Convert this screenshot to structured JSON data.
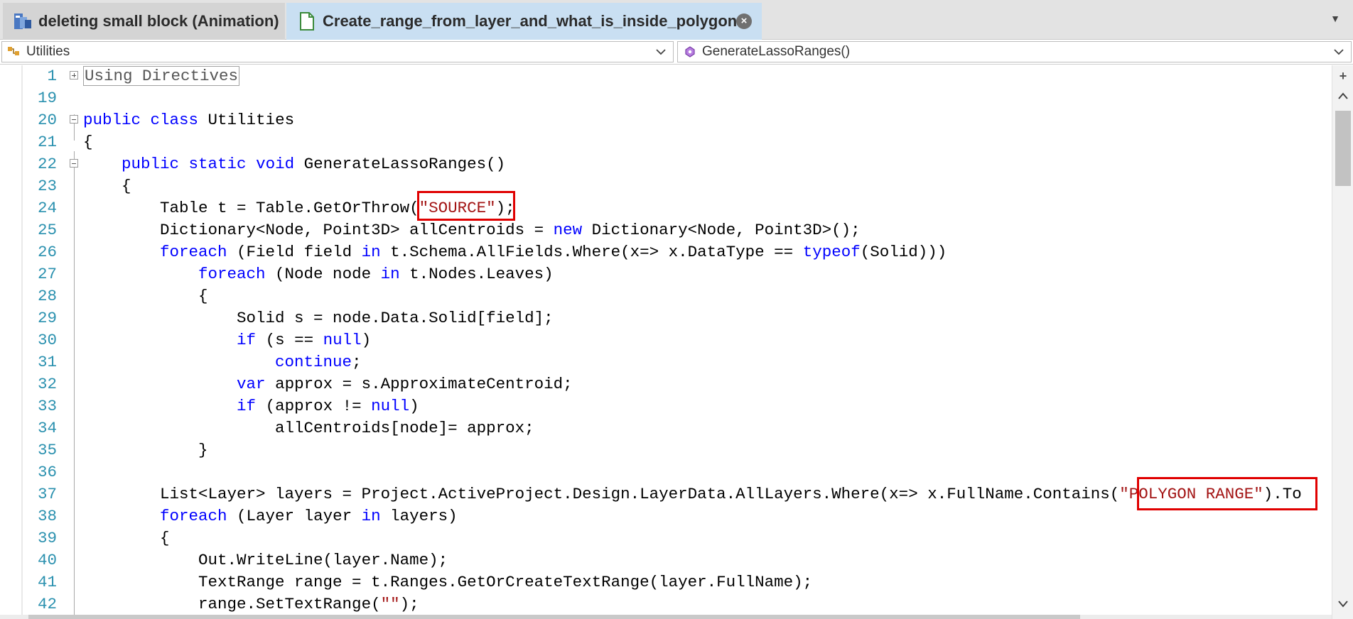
{
  "tabs": [
    {
      "label": "deleting small block (Animation)",
      "icon": "animation-project-icon",
      "active": false
    },
    {
      "label": "Create_range_from_layer_and_what_is_inside_polygon",
      "icon": "document-icon",
      "active": true
    }
  ],
  "navigation": {
    "type_dropdown": {
      "value": "Utilities",
      "icon": "class-icon"
    },
    "member_dropdown": {
      "value": "GenerateLassoRanges()",
      "icon": "method-icon"
    }
  },
  "editor": {
    "lines": [
      {
        "num": "1",
        "fold": "plus",
        "tokens": [
          {
            "t": "Using Directives",
            "c": "collapsed"
          }
        ]
      },
      {
        "num": "19",
        "fold": "",
        "tokens": []
      },
      {
        "num": "20",
        "fold": "minus",
        "tokens": [
          {
            "t": "public",
            "c": "kw"
          },
          {
            "t": " "
          },
          {
            "t": "class",
            "c": "kw"
          },
          {
            "t": " Utilities"
          }
        ]
      },
      {
        "num": "21",
        "fold": "",
        "tokens": [
          {
            "t": "{"
          }
        ]
      },
      {
        "num": "22",
        "fold": "minus",
        "tokens": [
          {
            "t": "    "
          },
          {
            "t": "public",
            "c": "kw"
          },
          {
            "t": " "
          },
          {
            "t": "static",
            "c": "kw"
          },
          {
            "t": " "
          },
          {
            "t": "void",
            "c": "kw"
          },
          {
            "t": " GenerateLassoRanges()"
          }
        ]
      },
      {
        "num": "23",
        "fold": "",
        "tokens": [
          {
            "t": "    {"
          }
        ]
      },
      {
        "num": "24",
        "fold": "",
        "tokens": [
          {
            "t": "        Table t = Table.GetOrThrow("
          },
          {
            "t": "\"SOURCE\"",
            "c": "str"
          },
          {
            "t": ");"
          }
        ]
      },
      {
        "num": "25",
        "fold": "",
        "tokens": [
          {
            "t": "        Dictionary<Node, Point3D> allCentroids = "
          },
          {
            "t": "new",
            "c": "kw"
          },
          {
            "t": " Dictionary<Node, Point3D>();"
          }
        ]
      },
      {
        "num": "26",
        "fold": "",
        "tokens": [
          {
            "t": "        "
          },
          {
            "t": "foreach",
            "c": "kw"
          },
          {
            "t": " (Field field "
          },
          {
            "t": "in",
            "c": "kw"
          },
          {
            "t": " t.Schema.AllFields.Where(x=> x.DataType == "
          },
          {
            "t": "typeof",
            "c": "kw"
          },
          {
            "t": "(Solid)))"
          }
        ]
      },
      {
        "num": "27",
        "fold": "",
        "tokens": [
          {
            "t": "            "
          },
          {
            "t": "foreach",
            "c": "kw"
          },
          {
            "t": " (Node node "
          },
          {
            "t": "in",
            "c": "kw"
          },
          {
            "t": " t.Nodes.Leaves)"
          }
        ]
      },
      {
        "num": "28",
        "fold": "",
        "tokens": [
          {
            "t": "            {"
          }
        ]
      },
      {
        "num": "29",
        "fold": "",
        "tokens": [
          {
            "t": "                Solid s = node.Data.Solid[field];"
          }
        ]
      },
      {
        "num": "30",
        "fold": "",
        "tokens": [
          {
            "t": "                "
          },
          {
            "t": "if",
            "c": "kw"
          },
          {
            "t": " (s == "
          },
          {
            "t": "null",
            "c": "kw"
          },
          {
            "t": ")"
          }
        ]
      },
      {
        "num": "31",
        "fold": "",
        "tokens": [
          {
            "t": "                    "
          },
          {
            "t": "continue",
            "c": "kw"
          },
          {
            "t": ";"
          }
        ]
      },
      {
        "num": "32",
        "fold": "",
        "tokens": [
          {
            "t": "                "
          },
          {
            "t": "var",
            "c": "kw"
          },
          {
            "t": " approx = s.ApproximateCentroid;"
          }
        ]
      },
      {
        "num": "33",
        "fold": "",
        "tokens": [
          {
            "t": "                "
          },
          {
            "t": "if",
            "c": "kw"
          },
          {
            "t": " (approx != "
          },
          {
            "t": "null",
            "c": "kw"
          },
          {
            "t": ")"
          }
        ]
      },
      {
        "num": "34",
        "fold": "",
        "tokens": [
          {
            "t": "                    allCentroids[node]= approx;"
          }
        ]
      },
      {
        "num": "35",
        "fold": "",
        "tokens": [
          {
            "t": "            }"
          }
        ]
      },
      {
        "num": "36",
        "fold": "",
        "tokens": []
      },
      {
        "num": "37",
        "fold": "",
        "tokens": [
          {
            "t": "        List<Layer> layers = Project.ActiveProject.Design.LayerData.AllLayers.Where(x=> x.FullName.Contains("
          },
          {
            "t": "\"POLYGON RANGE\"",
            "c": "str"
          },
          {
            "t": ").To"
          }
        ]
      },
      {
        "num": "38",
        "fold": "",
        "tokens": [
          {
            "t": "        "
          },
          {
            "t": "foreach",
            "c": "kw"
          },
          {
            "t": " (Layer layer "
          },
          {
            "t": "in",
            "c": "kw"
          },
          {
            "t": " layers)"
          }
        ]
      },
      {
        "num": "39",
        "fold": "",
        "tokens": [
          {
            "t": "        {"
          }
        ]
      },
      {
        "num": "40",
        "fold": "",
        "tokens": [
          {
            "t": "            Out.WriteLine(layer.Name);"
          }
        ]
      },
      {
        "num": "41",
        "fold": "",
        "tokens": [
          {
            "t": "            TextRange range = t.Ranges.GetOrCreateTextRange(layer.FullName);"
          }
        ]
      },
      {
        "num": "42",
        "fold": "",
        "tokens": [
          {
            "t": "            range.SetTextRange("
          },
          {
            "t": "\"\"",
            "c": "str"
          },
          {
            "t": ");"
          }
        ]
      }
    ]
  },
  "colors": {
    "keyword": "#0000ff",
    "string": "#a31515",
    "line_number": "#2b91af",
    "highlight_box": "#e00000",
    "active_tab": "#c9dff2"
  }
}
